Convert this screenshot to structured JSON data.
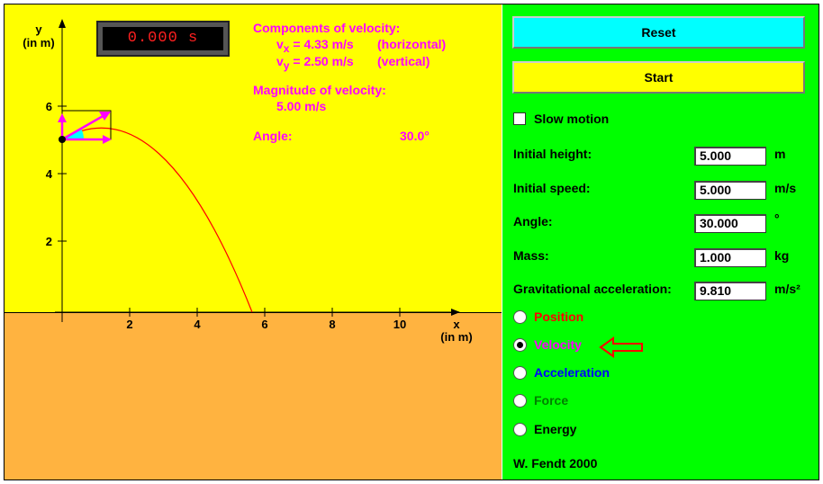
{
  "timer": {
    "value": "0.000 s"
  },
  "axes": {
    "y_label": "y",
    "y_unit": "(in m)",
    "x_label": "x",
    "x_unit": "(in m)",
    "x_ticks": [
      "2",
      "4",
      "6",
      "8",
      "10"
    ],
    "y_ticks": [
      "2",
      "4",
      "6"
    ]
  },
  "info": {
    "components_title": "Components of velocity:",
    "vx_symbol": "v",
    "vx_sub": "x",
    "vx_value": "= 4.33 m/s",
    "vx_note": "(horizontal)",
    "vy_symbol": "v",
    "vy_sub": "y",
    "vy_value": "= 2.50 m/s",
    "vy_note": "(vertical)",
    "magnitude_title": "Magnitude of velocity:",
    "magnitude_value": "5.00 m/s",
    "angle_label": "Angle:",
    "angle_value": "30.0°"
  },
  "controls": {
    "reset_label": "Reset",
    "start_label": "Start",
    "slow_motion_label": "Slow motion",
    "slow_motion_checked": false,
    "fields": [
      {
        "label": "Initial height:",
        "value": "5.000",
        "unit": "m"
      },
      {
        "label": "Initial speed:",
        "value": "5.000",
        "unit": "m/s"
      },
      {
        "label": "Angle:",
        "value": "30.000",
        "unit": "°"
      },
      {
        "label": "Mass:",
        "value": "1.000",
        "unit": "kg"
      },
      {
        "label": "Gravitational acceleration:",
        "value": "9.810",
        "unit": "m/s²"
      }
    ],
    "options": [
      {
        "label": "Position",
        "color": "#ff0000",
        "selected": false
      },
      {
        "label": "Velocity",
        "color": "#ff00ff",
        "selected": true
      },
      {
        "label": "Acceleration",
        "color": "#0000ff",
        "selected": false
      },
      {
        "label": "Force",
        "color": "#008000",
        "selected": false
      },
      {
        "label": "Energy",
        "color": "#000000",
        "selected": false
      }
    ]
  },
  "credit": "W. Fendt 2000",
  "colors": {
    "sky": "#ffff00",
    "ground": "#ffb340",
    "panel": "#00ff00",
    "trajectory": "#ff0000",
    "velocity": "#ff00ff",
    "angle_arc": "#00ffff",
    "pointer_arrow": "#ff0000"
  }
}
